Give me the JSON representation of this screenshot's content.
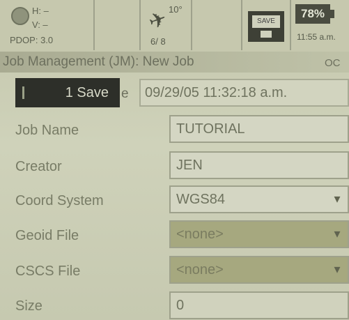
{
  "status": {
    "gps": {
      "h_label": "H: ‒",
      "v_label": "V: ‒",
      "pdop": "PDOP: 3.0"
    },
    "satellites": {
      "angle": "10°",
      "count": "6/ 8"
    },
    "storage": {
      "label": "SAVE"
    },
    "battery": {
      "percent": "78%",
      "time": "11:55 a.m."
    }
  },
  "title": {
    "text": "Job Management (JM): New Job",
    "suffix": "OC"
  },
  "save_row": {
    "button": "1 Save",
    "tail": "e",
    "datetime": "09/29/05 11:32:18 a.m."
  },
  "form": {
    "job_name": {
      "label": "Job Name",
      "value": "TUTORIAL"
    },
    "creator": {
      "label": "Creator",
      "value": "JEN"
    },
    "coord_system": {
      "label": "Coord System",
      "value": "WGS84"
    },
    "geoid_file": {
      "label": "Geoid File",
      "value": "<none>"
    },
    "cscs_file": {
      "label": "CSCS File",
      "value": "<none>"
    },
    "size": {
      "label": "Size",
      "value": "0"
    }
  },
  "colors": {
    "screen": "#c9cdb3",
    "button_dark": "#2d2f29",
    "dim_field": "#a6a87f"
  },
  "icons": [
    "gps-icon",
    "satellite-icon",
    "floppy-disk-icon",
    "battery-icon",
    "chevron-down-icon"
  ]
}
